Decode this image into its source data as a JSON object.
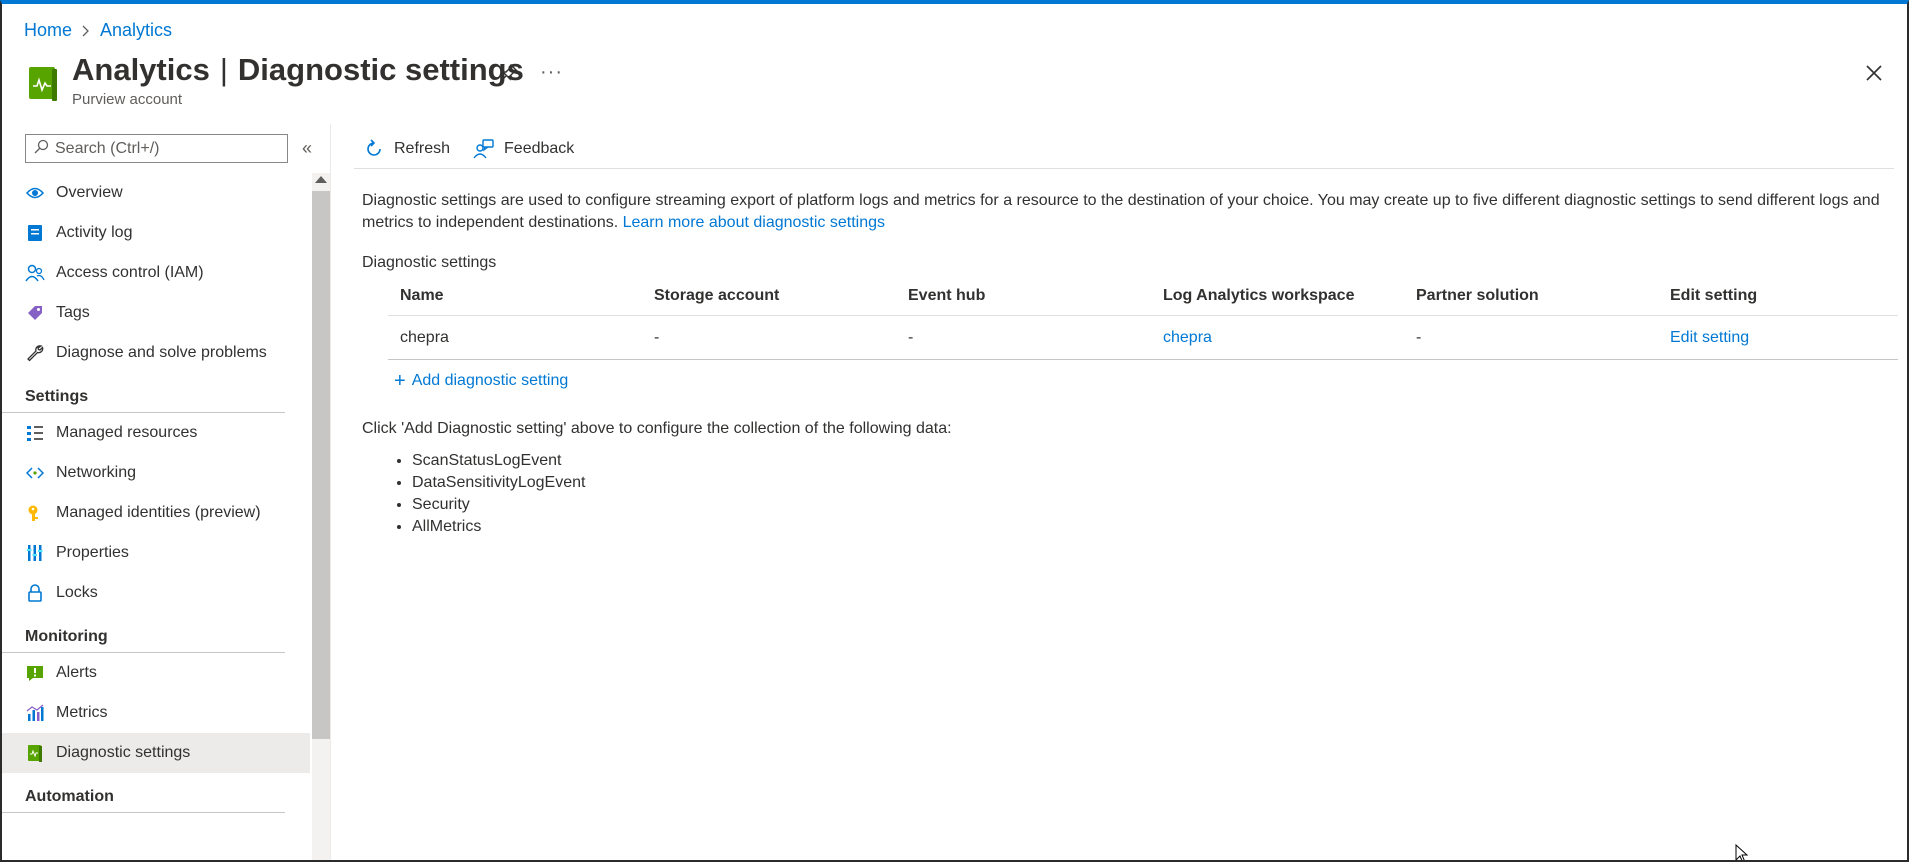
{
  "breadcrumb": {
    "home": "Home",
    "current": "Analytics"
  },
  "header": {
    "resource_name": "Analytics",
    "page_name": "Diagnostic settings",
    "separator": "|",
    "subtitle": "Purview account",
    "more_label": "···"
  },
  "search": {
    "placeholder": "Search (Ctrl+/)"
  },
  "sidebar": {
    "collapse_label": "«",
    "items": [
      {
        "label": "Overview",
        "icon": "eye-icon"
      },
      {
        "label": "Activity log",
        "icon": "activity-log-icon"
      },
      {
        "label": "Access control (IAM)",
        "icon": "people-icon"
      },
      {
        "label": "Tags",
        "icon": "tag-icon"
      },
      {
        "label": "Diagnose and solve problems",
        "icon": "wrench-icon"
      }
    ],
    "settings_header": "Settings",
    "settings_items": [
      {
        "label": "Managed resources",
        "icon": "resources-icon"
      },
      {
        "label": "Networking",
        "icon": "networking-icon"
      },
      {
        "label": "Managed identities (preview)",
        "icon": "key-icon"
      },
      {
        "label": "Properties",
        "icon": "properties-icon"
      },
      {
        "label": "Locks",
        "icon": "lock-icon"
      }
    ],
    "monitoring_header": "Monitoring",
    "monitoring_items": [
      {
        "label": "Alerts",
        "icon": "alert-icon"
      },
      {
        "label": "Metrics",
        "icon": "metrics-icon"
      },
      {
        "label": "Diagnostic settings",
        "icon": "diagnostic-settings-icon"
      }
    ],
    "automation_header": "Automation"
  },
  "toolbar": {
    "refresh_label": "Refresh",
    "feedback_label": "Feedback"
  },
  "content": {
    "description": "Diagnostic settings are used to configure streaming export of platform logs and metrics for a resource to the destination of your choice. You may create up to five different diagnostic settings to send different logs and metrics to independent destinations.",
    "learn_more": "Learn more about diagnostic settings",
    "section_label": "Diagnostic settings",
    "columns": [
      "Name",
      "Storage account",
      "Event hub",
      "Log Analytics workspace",
      "Partner solution",
      "Edit setting"
    ],
    "rows": [
      {
        "name": "chepra",
        "storage": "-",
        "event_hub": "-",
        "workspace": "chepra",
        "partner": "-",
        "edit": "Edit setting"
      }
    ],
    "add_label": "Add diagnostic setting",
    "add_plus": "+",
    "hint": "Click 'Add Diagnostic setting' above to configure the collection of the following data:",
    "data_items": [
      "ScanStatusLogEvent",
      "DataSensitivityLogEvent",
      "Security",
      "AllMetrics"
    ]
  },
  "colors": {
    "accent": "#0078d4",
    "active_bg": "#edebe9",
    "icon_green": "#57a300"
  }
}
